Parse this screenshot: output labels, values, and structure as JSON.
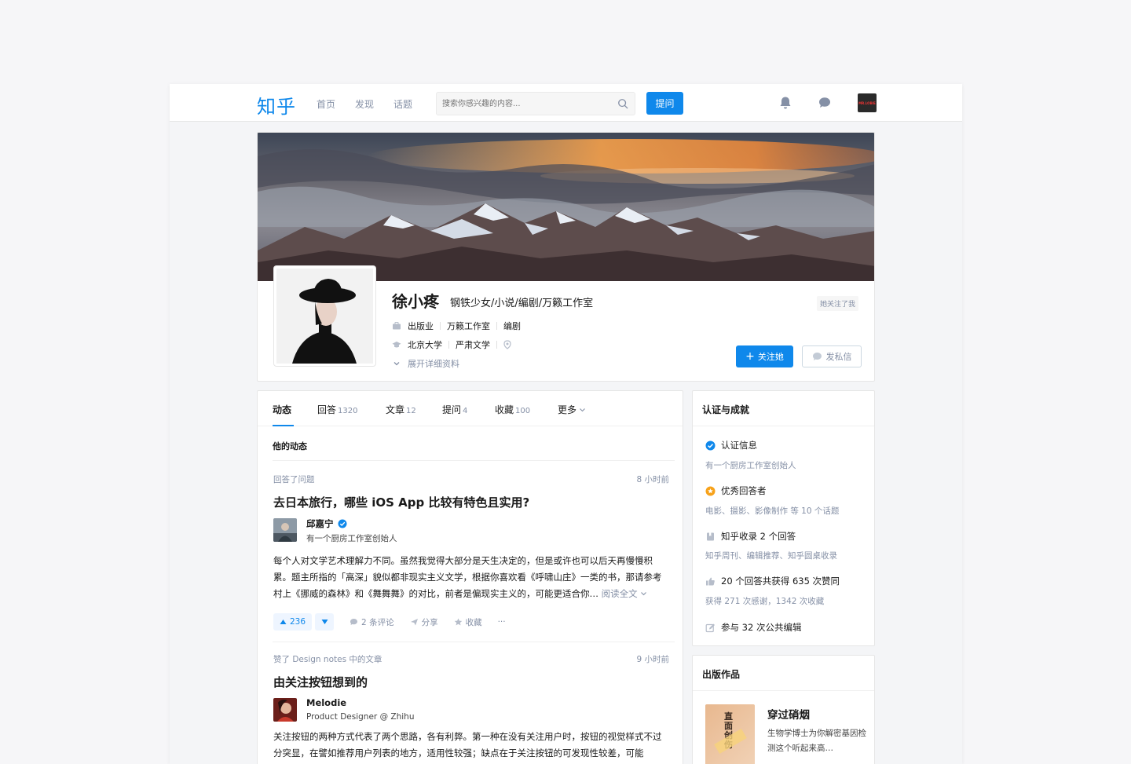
{
  "topbar": {
    "logo": "知乎",
    "nav": [
      "首页",
      "发现",
      "话题"
    ],
    "search_placeholder": "搜索你感兴趣的内容...",
    "ask_label": "提问",
    "avatar_text": "MR.LOBIE"
  },
  "profile": {
    "name": "徐小疼",
    "headline": "钢铁少女/小说/编剧/万籁工作室",
    "follows_me": "她关注了我",
    "industry": "出版业",
    "company": "万籁工作室",
    "position": "编剧",
    "school": "北京大学",
    "major": "严肃文学",
    "expand_label": "展开详细资料",
    "follow_label": "关注她",
    "message_label": "发私信"
  },
  "tabs": [
    {
      "label": "动态",
      "count": ""
    },
    {
      "label": "回答",
      "count": "1320"
    },
    {
      "label": "文章",
      "count": "12"
    },
    {
      "label": "提问",
      "count": "4"
    },
    {
      "label": "收藏",
      "count": "100"
    },
    {
      "label": "更多",
      "count": ""
    }
  ],
  "feed": {
    "section_title": "他的动态",
    "items": [
      {
        "action": "回答了问题",
        "time": "8 小时前",
        "title": "去日本旅行，哪些 iOS App 比较有特色且实用?",
        "author": "邱嘉宁",
        "bio": "有一个厨房工作室创始人",
        "excerpt": "每个人对文学艺术理解力不同。虽然我觉得大部分是天生决定的，但是或许也可以后天再慢慢积累。题主所指的「高深」貌似都非现实主义文学，根据你喜欢看《呼啸山庄》一类的书，那请参考村上《挪威的森林》和《舞舞舞》的对比，前者是偏现实主义的，可能更适合你…",
        "read_more": "阅读全文",
        "votes": "236",
        "comments": "2 条评论",
        "share": "分享",
        "collect": "收藏",
        "more": "···"
      },
      {
        "action": "赞了 Design notes 中的文章",
        "time": "9 小时前",
        "title": "由关注按钮想到的",
        "author": "Melodie",
        "bio": "Product Designer @ Zhihu",
        "excerpt": "关注按钮的两种方式代表了两个思路，各有利弊。第一种在没有关注用户时，按钮的视觉样式不过分突显，在譬如推荐用户列表的地方，适用性较强；缺点在于关注按钮的可发现性较差，可能"
      }
    ]
  },
  "achievements": {
    "title": "认证与成就",
    "items": [
      {
        "head": "认证信息",
        "sub": "有一个厨房工作室创始人"
      },
      {
        "head": "优秀回答者",
        "sub": "电影、摄影、影像制作 等 10 个话题"
      },
      {
        "head": "知乎收录 2 个回答",
        "sub": "知乎周刊、编辑推荐、知乎圆桌收录"
      },
      {
        "head": "20 个回答共获得 635 次赞同",
        "sub": "获得 271 次感谢，1342 次收藏"
      },
      {
        "head": "参与 32 次公共编辑",
        "sub": ""
      }
    ]
  },
  "publications": {
    "title": "出版作品",
    "book_title": "穿过硝烟",
    "book_desc": "生物学博士为你解密基因检测这个听起来高…",
    "cover_text": "直面创伤"
  }
}
